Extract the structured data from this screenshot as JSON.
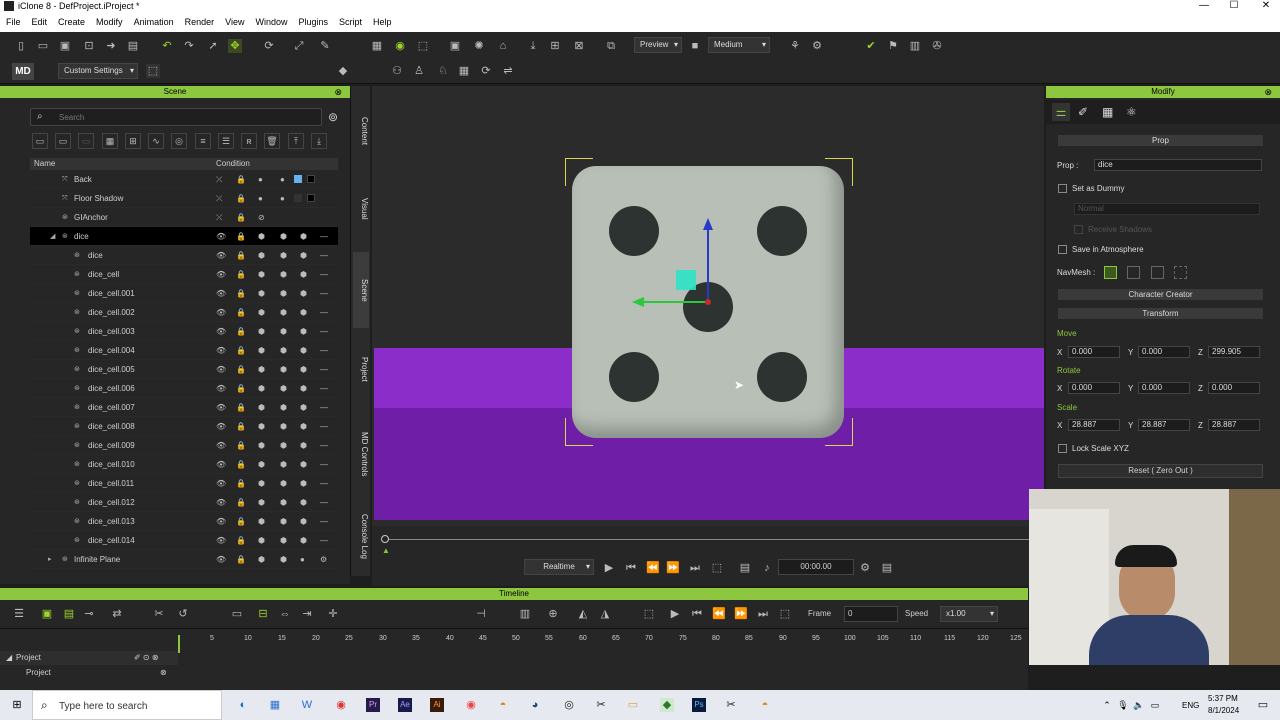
{
  "window": {
    "title": "iClone 8 - DefProject.iProject *",
    "minimize": "—",
    "maximize": "☐",
    "close": "✕"
  },
  "menu": [
    "File",
    "Edit",
    "Create",
    "Modify",
    "Animation",
    "Render",
    "View",
    "Window",
    "Plugins",
    "Script",
    "Help"
  ],
  "toolbar": {
    "preview_label": "Preview",
    "quality_label": "Medium",
    "settings_label": "Custom Settings"
  },
  "scene": {
    "title": "Scene",
    "search_placeholder": "Search",
    "col_name": "Name",
    "col_condition": "Condition",
    "rows": [
      {
        "name": "Back"
      },
      {
        "name": "Floor Shadow"
      },
      {
        "name": "GIAnchor"
      },
      {
        "name": "dice"
      },
      {
        "name": "dice"
      },
      {
        "name": "dice_cell"
      },
      {
        "name": "dice_cell.001"
      },
      {
        "name": "dice_cell.002"
      },
      {
        "name": "dice_cell.003"
      },
      {
        "name": "dice_cell.004"
      },
      {
        "name": "dice_cell.005"
      },
      {
        "name": "dice_cell.006"
      },
      {
        "name": "dice_cell.007"
      },
      {
        "name": "dice_cell.008"
      },
      {
        "name": "dice_cell.009"
      },
      {
        "name": "dice_cell.010"
      },
      {
        "name": "dice_cell.011"
      },
      {
        "name": "dice_cell.012"
      },
      {
        "name": "dice_cell.013"
      },
      {
        "name": "dice_cell.014"
      },
      {
        "name": "Infinite Plane"
      }
    ]
  },
  "vtabs": [
    "Content",
    "Visual",
    "Scene",
    "Project",
    "MD Controls",
    "Console Log"
  ],
  "transport": {
    "mode": "Realtime",
    "time": "00:00.00"
  },
  "timeline": {
    "title": "Timeline",
    "frame_label": "Frame",
    "frame_value": "0",
    "speed_label": "Speed",
    "speed_value": "x1.00",
    "ticks": [
      "5",
      "10",
      "15",
      "20",
      "25",
      "30",
      "35",
      "40",
      "45",
      "50",
      "55",
      "60",
      "65",
      "70",
      "75",
      "80",
      "85",
      "90",
      "95",
      "100",
      "105",
      "110",
      "115",
      "120",
      "125"
    ],
    "track1": "Project",
    "track2": "Project"
  },
  "modify": {
    "title": "Modify",
    "section_prop": "Prop",
    "prop_label": "Prop :",
    "prop_value": "dice",
    "set_as_dummy": "Set as Dummy",
    "normal": "Normal",
    "receive_shadows": "Receive Shadows",
    "save_in_atmosphere": "Save in Atmosphere",
    "navmesh": "NavMesh :",
    "character_creator": "Character Creator",
    "transform": "Transform",
    "move": "Move",
    "rotate": "Rotate",
    "scale": "Scale",
    "move_x": "0.000",
    "move_y": "0.000",
    "move_z": "299.905",
    "rot_x": "0.000",
    "rot_y": "0.000",
    "rot_z": "0.000",
    "scale_x": "28.887",
    "scale_y": "28.887",
    "scale_z": "28.887",
    "lock_scale": "Lock Scale XYZ",
    "reset": "Reset ( Zero Out )",
    "axis_x": "X",
    "axis_y": "Y",
    "axis_z": "Z"
  },
  "taskbar": {
    "search_placeholder": "Type here to search",
    "lang": "ENG",
    "time": "5:37 PM",
    "date": "8/1/2024"
  },
  "colors": {
    "accent": "#8dc63f",
    "floor": "#8a2dc9",
    "dice": "#b7bfb6"
  }
}
